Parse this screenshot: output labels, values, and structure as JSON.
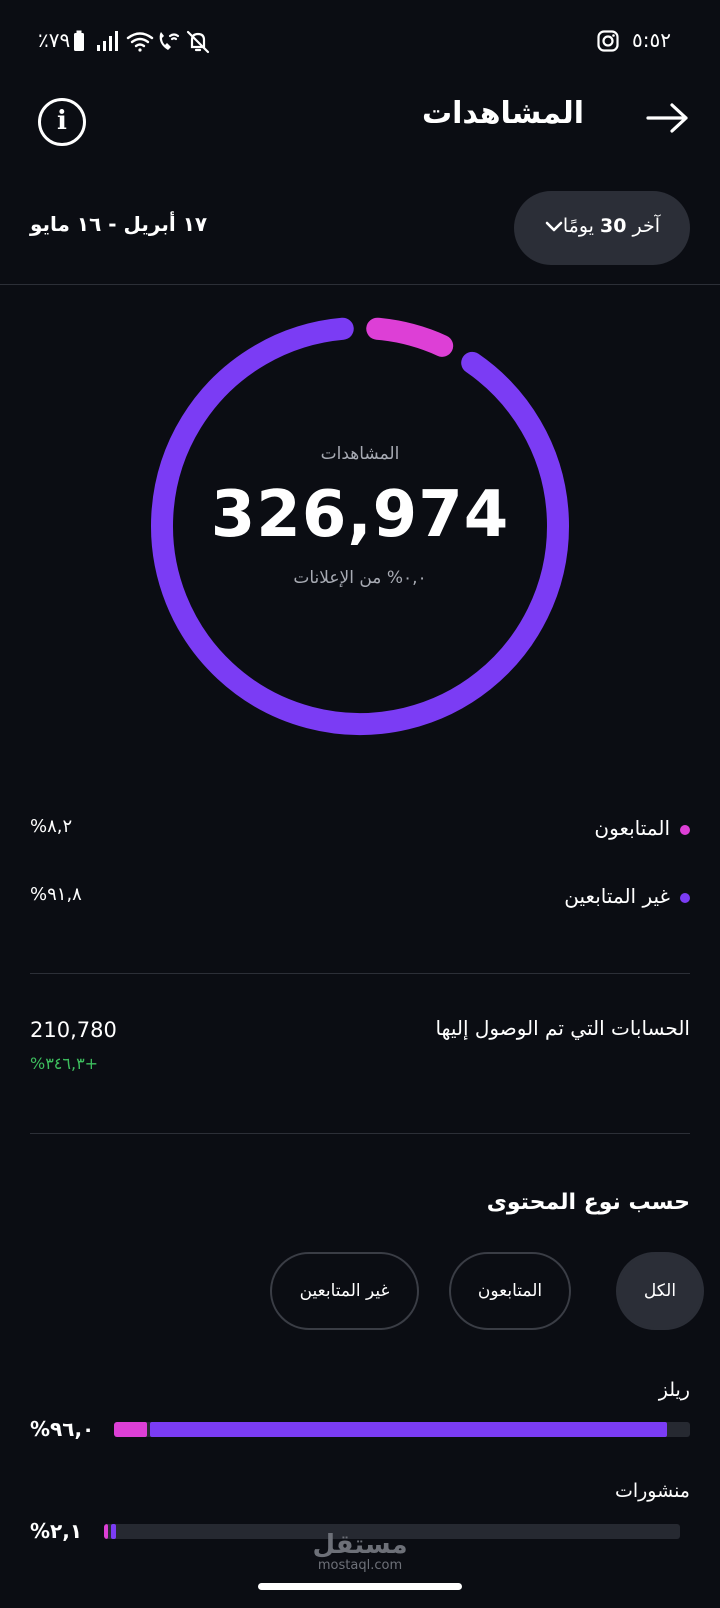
{
  "status_bar": {
    "time": "٥:٥٢",
    "battery": "٪٧٩"
  },
  "header": {
    "title": "المشاهدات"
  },
  "date_filter": {
    "range": "١٧ أبريل - ١٦ مايو",
    "period_prefix": "آخر",
    "period_number": "30",
    "period_suffix": "يومًا"
  },
  "summary": {
    "label": "المشاهدات",
    "total": "326,974",
    "ads_share": "٠,٠% من الإعلانات",
    "followers_fraction": 0.082,
    "colors": {
      "followers": "#dd3fd6",
      "non_followers": "#7b3cf4"
    }
  },
  "legend": [
    {
      "name": "المتابعون",
      "percent": "%٨,٢",
      "color": "#dd3fd6"
    },
    {
      "name": "غير المتابعين",
      "percent": "%٩١,٨",
      "color": "#7b3cf4"
    }
  ],
  "accounts_reached": {
    "label": "الحسابات التي تم الوصول إليها",
    "value": "210,780",
    "change": "%٣٤٦,٣+"
  },
  "content_type": {
    "title": "حسب نوع المحتوى",
    "tabs": [
      {
        "label": "الكل",
        "active": true
      },
      {
        "label": "المتابعون",
        "active": false
      },
      {
        "label": "غير المتابعين",
        "active": false
      }
    ],
    "rows": [
      {
        "label": "ريلز",
        "percent": "%٩٦,٠",
        "value": 0.96
      },
      {
        "label": "منشورات",
        "percent": "%٢,١",
        "value": 0.021
      }
    ]
  },
  "watermark": {
    "arabic": "مستقل",
    "latin": "mostaql.com"
  }
}
